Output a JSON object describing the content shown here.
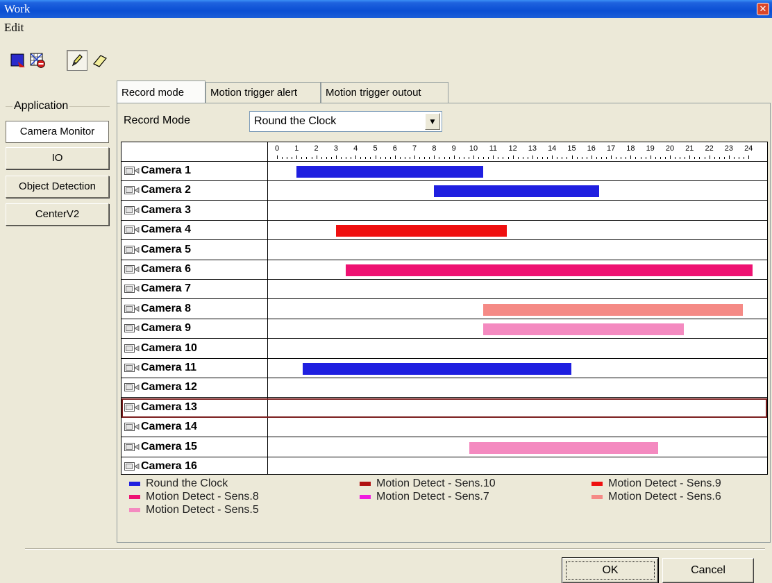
{
  "window": {
    "title": "Work"
  },
  "menu": {
    "edit": "Edit"
  },
  "toolbar": [
    {
      "name": "color-swatch-icon"
    },
    {
      "name": "grid-erase-icon"
    },
    {
      "name": "pencil-icon"
    },
    {
      "name": "eraser-icon"
    }
  ],
  "sidebar": {
    "group_label": "Application",
    "items": [
      {
        "label": "Camera Monitor",
        "selected": true
      },
      {
        "label": "IO",
        "selected": false
      },
      {
        "label": "Object Detection",
        "selected": false
      },
      {
        "label": "CenterV2",
        "selected": false
      }
    ]
  },
  "tabs": [
    {
      "label": "Record mode",
      "active": true
    },
    {
      "label": "Motion trigger alert",
      "active": false
    },
    {
      "label": "Motion trigger outout",
      "active": false
    }
  ],
  "record_mode": {
    "label": "Record Mode",
    "selected": "Round the Clock"
  },
  "colors": {
    "round_the_clock": "#1f1fe0",
    "sens10": "#b01010",
    "sens9": "#ef1010",
    "sens8": "#ee1272",
    "sens7": "#f01ce0",
    "sens6": "#f58a86",
    "sens5": "#f48ac0"
  },
  "schedule": {
    "hours": [
      "0",
      "1",
      "2",
      "3",
      "4",
      "5",
      "6",
      "7",
      "8",
      "9",
      "10",
      "11",
      "12",
      "13",
      "14",
      "15",
      "16",
      "17",
      "18",
      "19",
      "20",
      "21",
      "22",
      "23",
      "24"
    ],
    "selected_row": 12,
    "cameras": [
      {
        "name": "Camera 1",
        "bar": {
          "start": 1,
          "end": 10.5,
          "mode": "round_the_clock"
        }
      },
      {
        "name": "Camera 2",
        "bar": {
          "start": 8,
          "end": 16.4,
          "mode": "round_the_clock"
        }
      },
      {
        "name": "Camera 3",
        "bar": null
      },
      {
        "name": "Camera 4",
        "bar": {
          "start": 3,
          "end": 11.7,
          "mode": "sens9"
        }
      },
      {
        "name": "Camera 5",
        "bar": null
      },
      {
        "name": "Camera 6",
        "bar": {
          "start": 3.5,
          "end": 24.2,
          "mode": "sens8"
        }
      },
      {
        "name": "Camera 7",
        "bar": null
      },
      {
        "name": "Camera 8",
        "bar": {
          "start": 10.5,
          "end": 23.7,
          "mode": "sens6"
        }
      },
      {
        "name": "Camera 9",
        "bar": {
          "start": 10.5,
          "end": 20.7,
          "mode": "sens5"
        }
      },
      {
        "name": "Camera 10",
        "bar": null
      },
      {
        "name": "Camera 11",
        "bar": {
          "start": 1.3,
          "end": 15,
          "mode": "round_the_clock"
        }
      },
      {
        "name": "Camera 12",
        "bar": null
      },
      {
        "name": "Camera 13",
        "bar": null
      },
      {
        "name": "Camera 14",
        "bar": null
      },
      {
        "name": "Camera 15",
        "bar": {
          "start": 9.8,
          "end": 19.4,
          "mode": "sens5"
        }
      },
      {
        "name": "Camera 16",
        "bar": null
      }
    ]
  },
  "legend": [
    {
      "label": "Round the Clock",
      "mode": "round_the_clock"
    },
    {
      "label": "Motion Detect - Sens.10",
      "mode": "sens10"
    },
    {
      "label": "Motion Detect - Sens.9",
      "mode": "sens9"
    },
    {
      "label": "Motion Detect - Sens.8",
      "mode": "sens8"
    },
    {
      "label": "Motion Detect - Sens.7",
      "mode": "sens7"
    },
    {
      "label": "Motion Detect - Sens.6",
      "mode": "sens6"
    },
    {
      "label": "Motion Detect - Sens.5",
      "mode": "sens5"
    }
  ],
  "buttons": {
    "ok": "OK",
    "cancel": "Cancel"
  }
}
